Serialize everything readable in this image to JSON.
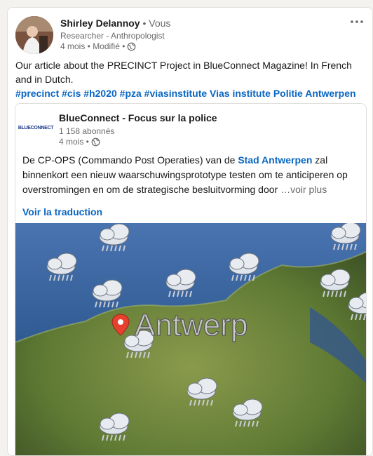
{
  "post": {
    "author": {
      "name": "Shirley Delannoy",
      "degree": " • Vous",
      "headline": "Researcher - Anthropologist",
      "meta": "4 mois • Modifié •"
    },
    "text": "Our article about the PRECINCT Project in BlueConnect Magazine! In French and in Dutch.",
    "hashtags": [
      "#precinct",
      "#cis",
      "#h2020",
      "#pza",
      "#viasinstitute"
    ],
    "mentions": [
      "Vias institute",
      "Politie Antwerpen"
    ]
  },
  "shared": {
    "logo_text": "BLUECONNECT",
    "org_name": "BlueConnect - Focus sur la police",
    "followers": "1 158 abonnés",
    "meta": "4 mois •",
    "text_before": "De CP-OPS (Commando Post Operaties) van de ",
    "mention": "Stad Antwerpen",
    "text_after": " zal binnenkort een nieuw waarschuwingsprototype testen om te anticiperen op overstromingen en om de strategische besluitvorming door",
    "see_more": "…voir plus",
    "translate": "Voir la traduction"
  },
  "media": {
    "map_label": "Antwerp"
  },
  "colors": {
    "link": "#0a66c2",
    "sea": "#3d6aa8",
    "land": "#6f8a3e"
  }
}
